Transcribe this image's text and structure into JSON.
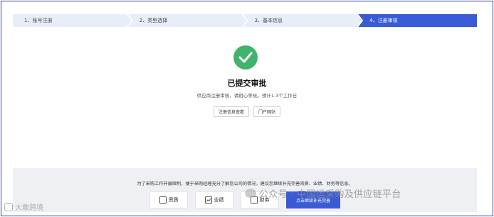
{
  "steps": [
    {
      "label": "1、账号注册"
    },
    {
      "label": "2、类型选择"
    },
    {
      "label": "3、基本信息"
    },
    {
      "label": "4、注册审核"
    }
  ],
  "status": {
    "icon": "check-circle-icon",
    "title": "已提交审批",
    "description": "供应商注册审核，请耐心等候。预计1-3个工作日"
  },
  "actions": {
    "view_registration": "注册信息查看",
    "portal_site": "门户网站"
  },
  "bottom_panel": {
    "text": "为了采购工作开展顺利，便于采购经理充分了解您公司的情况，建议您继续补充完善资质、业绩、财务等信息。",
    "cards": [
      {
        "label": "资质",
        "icon": "certificate-icon"
      },
      {
        "label": "业绩",
        "icon": "chart-icon"
      },
      {
        "label": "财务",
        "icon": "finance-icon"
      }
    ],
    "continue_label": "点击继续补充完善"
  },
  "watermarks": {
    "left": "大敢跨境",
    "right": "公众号 · 中国运采购及供应链平台"
  },
  "colors": {
    "accent": "#3a5bd6",
    "success": "#3fb46b",
    "step_inactive": "#e8eef8"
  }
}
